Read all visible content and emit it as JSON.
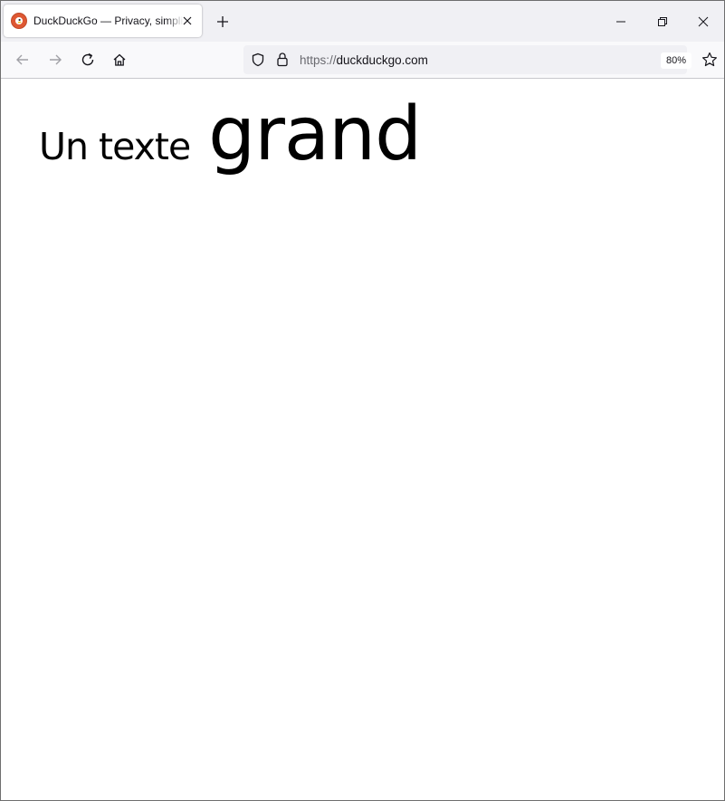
{
  "browser": {
    "tab": {
      "title": "DuckDuckGo — Privacy, simplified.",
      "favicon": "duckduckgo-favicon-icon",
      "accent": "#de5833"
    },
    "toolbar": {
      "url_scheme": "https://",
      "url_host": "duckduckgo.com",
      "zoom": "80%"
    },
    "icons": {
      "back": "arrow-left-icon",
      "forward": "arrow-right-icon",
      "reload": "reload-icon",
      "home": "home-icon",
      "shield": "shield-icon",
      "lock": "lock-icon",
      "bookmark": "star-icon",
      "new_tab": "plus-icon",
      "minimize": "minimize-icon",
      "maximize": "restore-icon",
      "close": "close-icon"
    }
  },
  "page": {
    "text_small": "Un texte",
    "text_big": "grand"
  }
}
